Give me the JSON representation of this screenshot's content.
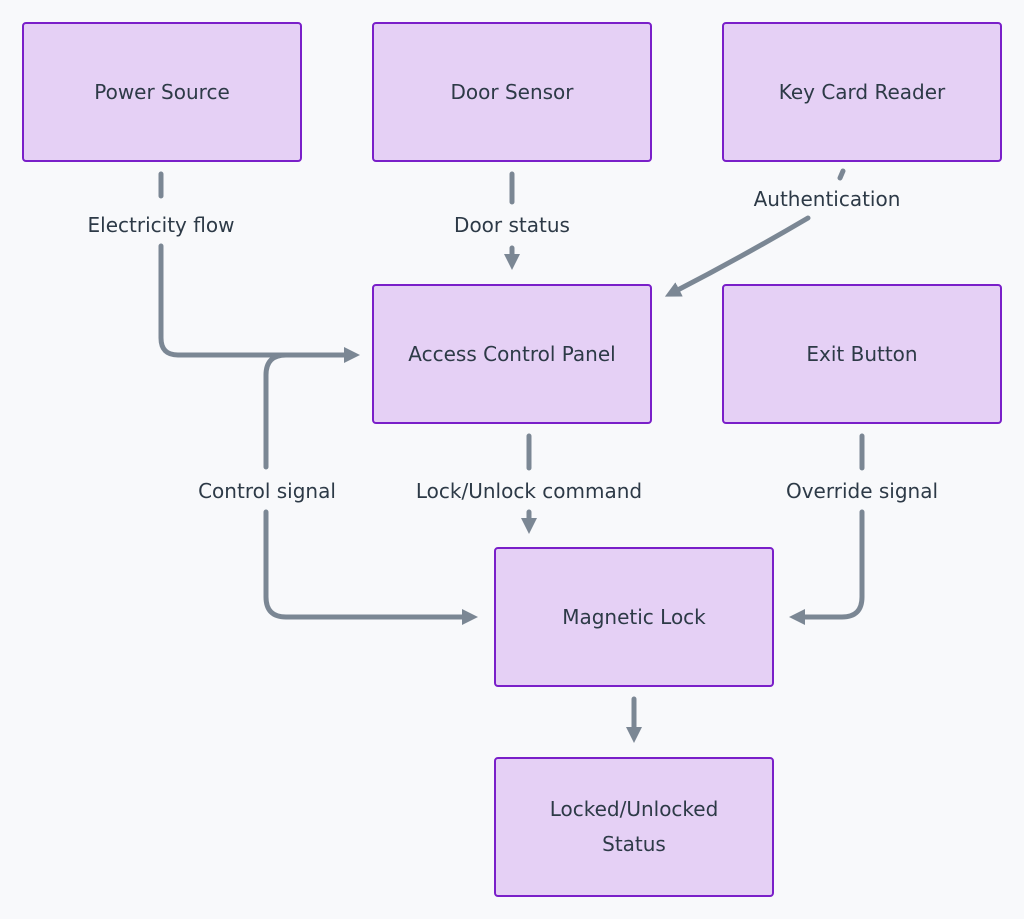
{
  "nodes": {
    "power_source": "Power Source",
    "door_sensor": "Door Sensor",
    "key_card_reader": "Key Card Reader",
    "access_control_panel": "Access Control Panel",
    "exit_button": "Exit Button",
    "magnetic_lock": "Magnetic Lock",
    "status_line1": "Locked/Unlocked",
    "status_line2": "Status"
  },
  "edges": {
    "electricity_flow": "Electricity flow",
    "door_status": "Door status",
    "authentication": "Authentication",
    "control_signal": "Control signal",
    "lock_unlock_command": "Lock/Unlock command",
    "override_signal": "Override signal"
  },
  "colors": {
    "background": "#f8f9fb",
    "node_fill": "#e5d0f5",
    "node_border": "#7a1fc9",
    "edge": "#7b8794",
    "text": "#2d3a47"
  }
}
